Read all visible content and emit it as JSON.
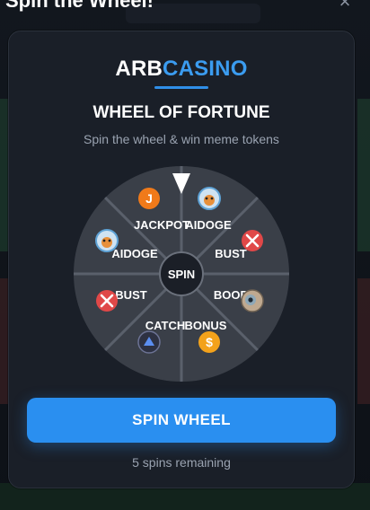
{
  "modal": {
    "title": "Spin the Wheel!",
    "close_symbol": "×"
  },
  "brand": {
    "part1": "ARB",
    "part2": "CASINO",
    "accent": "#3b9cf0"
  },
  "heading": "WHEEL OF FORTUNE",
  "subtitle": "Spin the wheel & win meme tokens",
  "wheel": {
    "center_label": "SPIN",
    "segments": [
      {
        "label": "JACKPOT",
        "icon": "jackpot-token-icon"
      },
      {
        "label": "AIDOGE",
        "icon": "aidoge-token-icon"
      },
      {
        "label": "BUST",
        "icon": "bust-x-icon"
      },
      {
        "label": "BOOP",
        "icon": "boop-token-icon"
      },
      {
        "label": "BONUS",
        "icon": "bonus-dollar-icon"
      },
      {
        "label": "CATCH",
        "icon": "catch-token-icon"
      },
      {
        "label": "BUST",
        "icon": "bust-x-icon"
      },
      {
        "label": "AIDOGE",
        "icon": "aidoge-token-icon"
      }
    ],
    "pointer_icon": "pointer-triangle-icon"
  },
  "spin_button": {
    "label": "SPIN WHEEL"
  },
  "spins_remaining": "5 spins remaining",
  "colors": {
    "button": "#2a8ff0",
    "wheel": "#3a3f48",
    "bust": "#e04848",
    "jackpot": "#f07a1a",
    "bonus": "#f3a21b"
  }
}
